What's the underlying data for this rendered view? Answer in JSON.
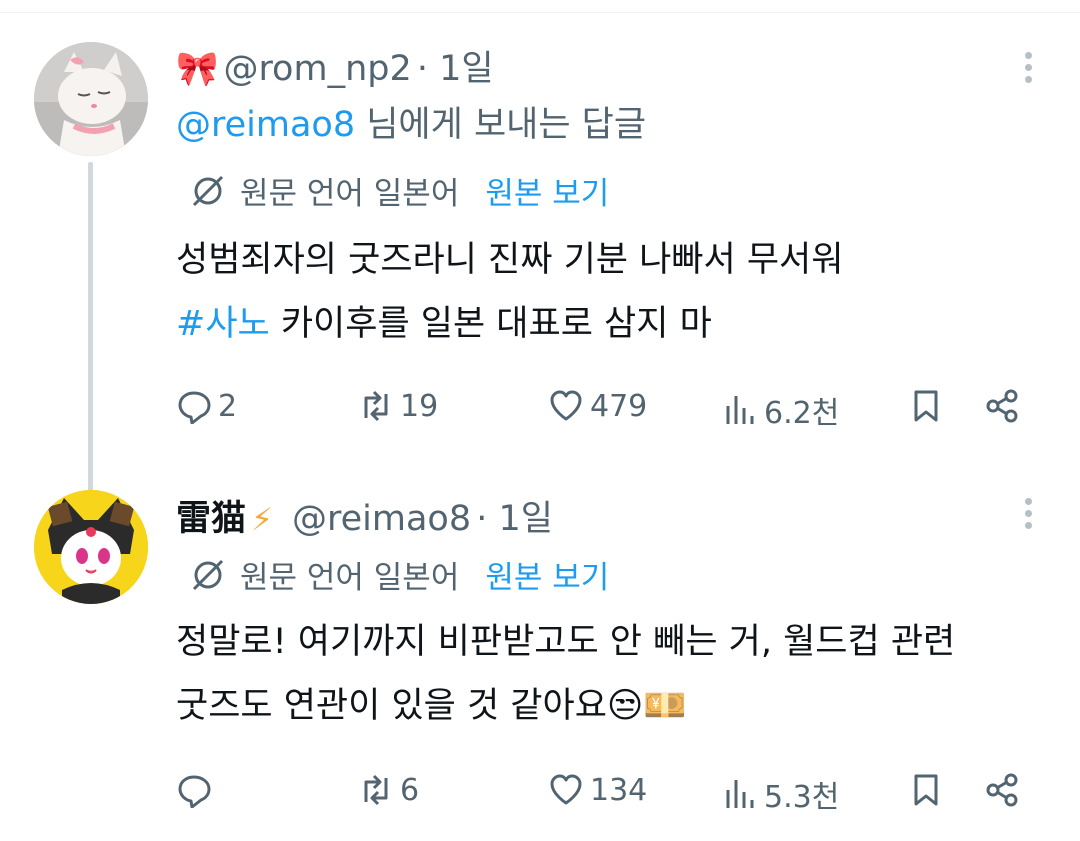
{
  "tweets": [
    {
      "name_emoji": "🎀",
      "handle": "@rom_np2",
      "time": "1일",
      "reply_mention": "@reimao8",
      "reply_suffix": " 님에게 보내는 답글",
      "translate_label": "원문 언어 일본어",
      "translate_link": "원본 보기",
      "line1": "성범죄자의 굿즈라니 진짜 기분 나빠서 무서워",
      "hashtag": "#사노",
      "line2_rest": " 카이후를 일본 대표로 삼지 마",
      "replies": "2",
      "retweets": "19",
      "likes": "479",
      "views": "6.2천"
    },
    {
      "name": "雷猫",
      "name_badge": "⚡",
      "handle": "@reimao8",
      "time": "1일",
      "translate_label": "원문 언어 일본어",
      "translate_link": "원본 보기",
      "line1": "정말로! 여기까지 비판받고도 안 빼는 거, 월드컵 관련",
      "line2": "굿즈도 연관이 있을 것 같아요😒💴",
      "replies": "",
      "retweets": "6",
      "likes": "134",
      "views": "5.3천"
    }
  ],
  "colors": {
    "accent": "#1d9bf0",
    "secondary": "#536471",
    "text": "#0f1419"
  },
  "icons": [
    "reply-icon",
    "retweet-icon",
    "like-icon",
    "views-icon",
    "bookmark-icon",
    "share-icon",
    "more-icon",
    "translate-icon"
  ]
}
